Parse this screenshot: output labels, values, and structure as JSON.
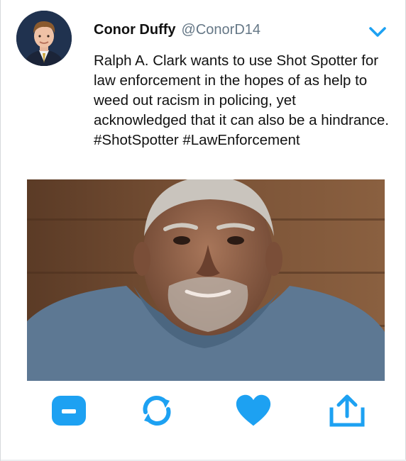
{
  "tweet": {
    "author": {
      "display_name": "Conor Duffy",
      "handle": "@ConorD14"
    },
    "text": "Ralph A. Clark wants to use Shot Spotter for law enforcement in the hopes of as help to weed out racism in policing, yet acknowledged that it can also be a hindrance.",
    "hashtags": "#ShotSpotter #LawEnforcement"
  },
  "actions": {
    "reply": "reply-icon",
    "retweet": "retweet-icon",
    "like": "heart-icon",
    "share": "share-icon"
  },
  "colors": {
    "accent": "#1da1f2",
    "text": "#111111",
    "muted": "#657786"
  }
}
